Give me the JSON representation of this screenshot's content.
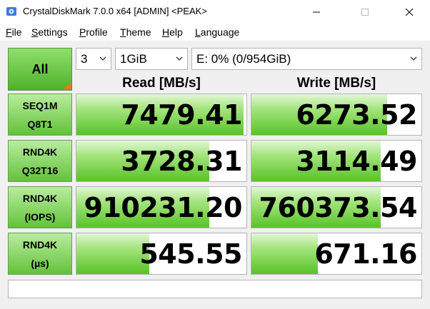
{
  "window": {
    "title": "CrystalDiskMark 7.0.0 x64 [ADMIN] <PEAK>",
    "app_icon": "disk-icon",
    "controls": [
      "minimize-icon",
      "maximize-icon",
      "close-icon"
    ]
  },
  "menu": [
    {
      "label": "File",
      "mnemonic": "F"
    },
    {
      "label": "Settings",
      "mnemonic": "S"
    },
    {
      "label": "Profile",
      "mnemonic": "P"
    },
    {
      "label": "Theme",
      "mnemonic": "T"
    },
    {
      "label": "Help",
      "mnemonic": "H"
    },
    {
      "label": "Language",
      "mnemonic": "L"
    }
  ],
  "controls": {
    "all_label": "All",
    "count": "3",
    "size": "1GiB",
    "drive": "E: 0% (0/954GiB)"
  },
  "columns": {
    "read": "Read [MB/s]",
    "write": "Write [MB/s]"
  },
  "rows": [
    {
      "label1": "SEQ1M",
      "label2": "Q8T1",
      "read": "7479.41",
      "write": "6273.52",
      "read_fill": 0.985,
      "write_fill": 0.8
    },
    {
      "label1": "RND4K",
      "label2": "Q32T16",
      "read": "3728.31",
      "write": "3114.49",
      "read_fill": 0.78,
      "write_fill": 0.76
    },
    {
      "label1": "RND4K",
      "label2": "(IOPS)",
      "read": "910231.20",
      "write": "760373.54",
      "read_fill": 0.78,
      "write_fill": 0.76
    },
    {
      "label1": "RND4K",
      "label2": "(µs)",
      "read": "545.55",
      "write": "671.16",
      "read_fill": 0.43,
      "write_fill": 0.39
    }
  ],
  "colors": {
    "accent_green": "#58c327",
    "corner_orange": "#f07820"
  },
  "status": ""
}
